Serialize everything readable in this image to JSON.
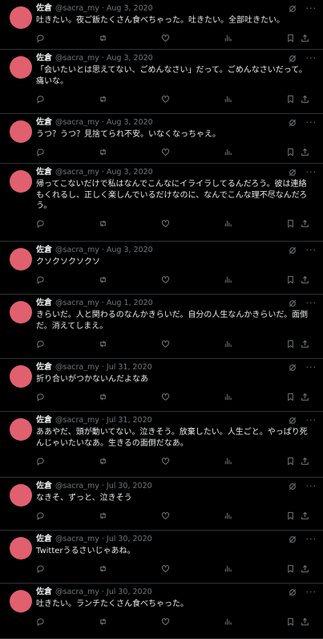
{
  "author": {
    "name": "佐倉",
    "handle": "@sacra_my"
  },
  "separator": "·",
  "tweets": [
    {
      "date": "Aug 3, 2020",
      "text": "吐きたい。夜ご飯たくさん食べちゃった。吐きたい。全部吐きたい。"
    },
    {
      "date": "Aug 3, 2020",
      "text": "「会いたいとは思えてない、ごめんなさい」だって。ごめんなさいだって。痛いな。"
    },
    {
      "date": "Aug 3, 2020",
      "text": "うつ？うつ？見捨てられ不安。いなくなっちゃえ。"
    },
    {
      "date": "Aug 3, 2020",
      "text": "帰ってこないだけで私はなんでこんなにイライラしてるんだろう。彼は連絡もくれるし、正しく楽しんでいるだけなのに、なんでこんな理不尽なんだろう。"
    },
    {
      "date": "Aug 3, 2020",
      "text": "クソクソクソクソ"
    },
    {
      "date": "Aug 1, 2020",
      "text": "きらいだ。人と関わるのなんかきらいだ。自分の人生なんかきらいだ。面倒だ。消えてしまえ。"
    },
    {
      "date": "Jul 31, 2020",
      "text": "折り合いがつかないんだよなあ"
    },
    {
      "date": "Jul 31, 2020",
      "text": "ああやだ、頭が動いてない。泣きそう。放棄したい。人生ごと。やっぱり死んじゃいたいなあ。生きるの面倒だなあ。"
    },
    {
      "date": "Jul 30, 2020",
      "text": "なきそ、ずっと、泣きそう"
    },
    {
      "date": "Jul 30, 2020",
      "text": "Twitterうるさいじゃあね。"
    },
    {
      "date": "Jul 30, 2020",
      "text": "吐きたい。ランチたくさん食べちゃった。"
    }
  ],
  "icons": {
    "header": [
      "grok-icon",
      "more-icon"
    ],
    "actions": [
      "reply-icon",
      "retweet-icon",
      "like-icon",
      "views-icon",
      "bookmark-icon",
      "share-icon"
    ]
  },
  "colors": {
    "background": "#000000",
    "text": "#e7e9ea",
    "muted": "#71767b",
    "divider": "#2f3336",
    "avatar": "#e0606f"
  }
}
